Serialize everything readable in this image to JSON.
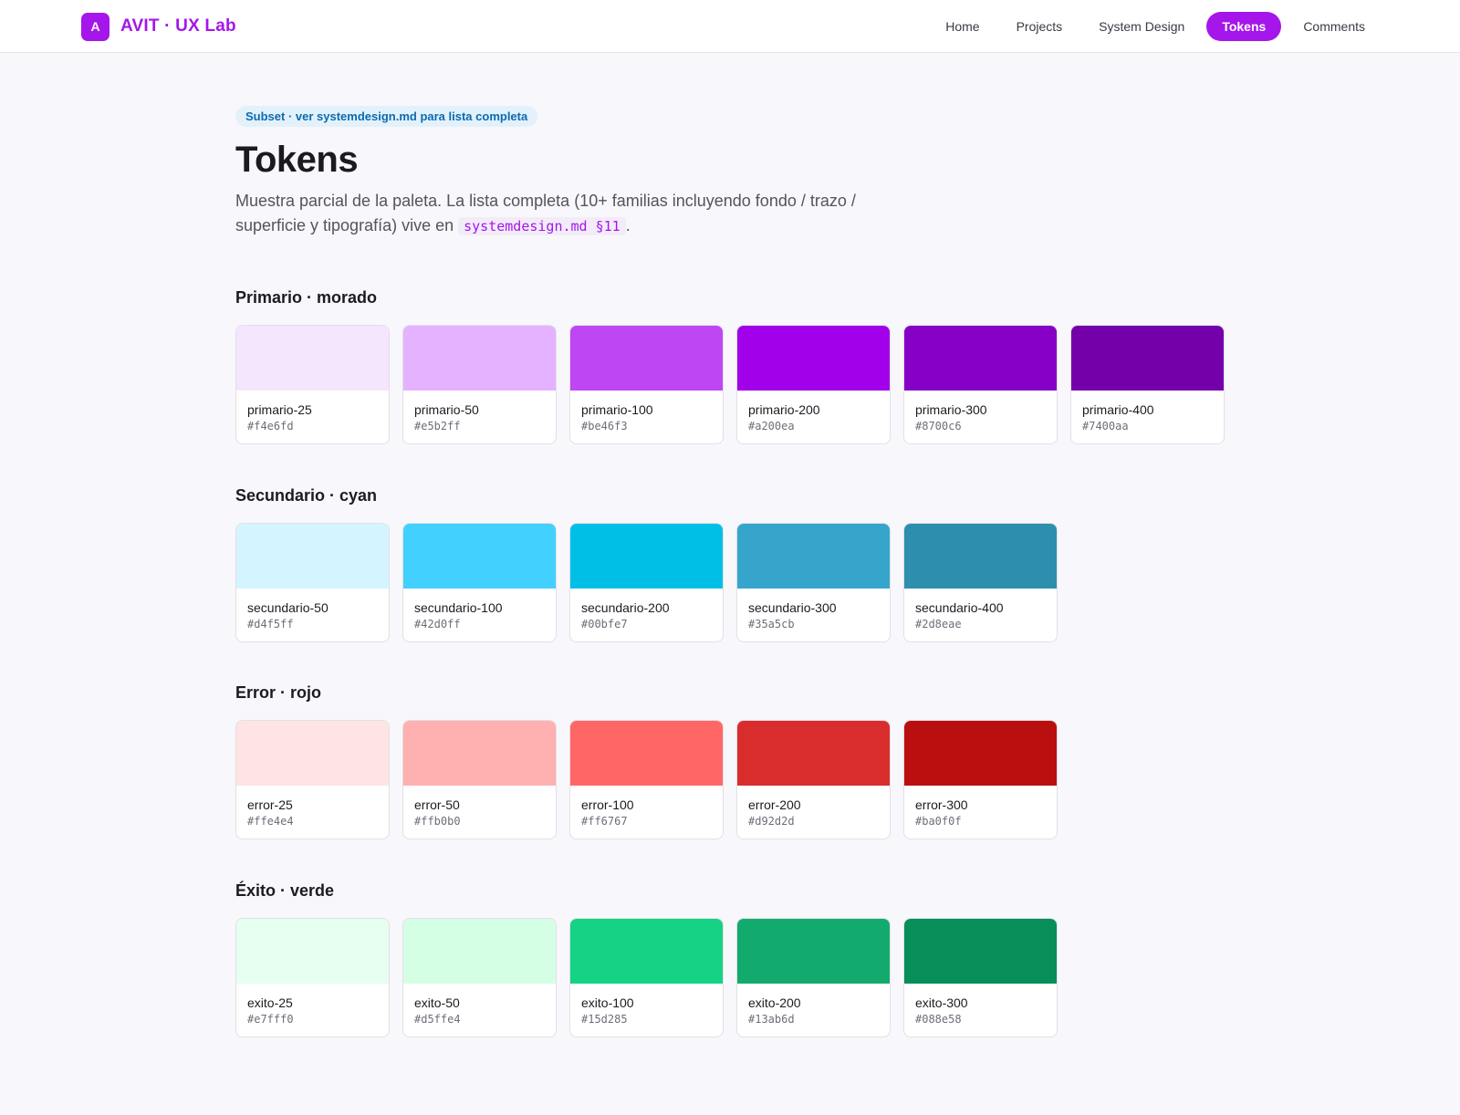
{
  "header": {
    "logo_letter": "A",
    "brand": "AVIT · UX Lab",
    "nav": [
      {
        "label": "Home",
        "active": false
      },
      {
        "label": "Projects",
        "active": false
      },
      {
        "label": "System Design",
        "active": false
      },
      {
        "label": "Tokens",
        "active": true
      },
      {
        "label": "Comments",
        "active": false
      }
    ]
  },
  "main": {
    "pill": "Subset · ver systemdesign.md para lista completa",
    "title": "Tokens",
    "lead_text": "Muestra parcial de la paleta. La lista completa (10+ familias incluyendo fondo / trazo / superficie y tipografía) vive en ",
    "lead_code": "systemdesign.md §11",
    "lead_end": "."
  },
  "sections": [
    {
      "title": "Primario · morado",
      "tokens": [
        {
          "name": "primario-25",
          "hex": "#f4e6fd"
        },
        {
          "name": "primario-50",
          "hex": "#e5b2ff"
        },
        {
          "name": "primario-100",
          "hex": "#be46f3"
        },
        {
          "name": "primario-200",
          "hex": "#a200ea"
        },
        {
          "name": "primario-300",
          "hex": "#8700c6"
        },
        {
          "name": "primario-400",
          "hex": "#7400aa"
        }
      ]
    },
    {
      "title": "Secundario · cyan",
      "tokens": [
        {
          "name": "secundario-50",
          "hex": "#d4f5ff"
        },
        {
          "name": "secundario-100",
          "hex": "#42d0ff"
        },
        {
          "name": "secundario-200",
          "hex": "#00bfe7"
        },
        {
          "name": "secundario-300",
          "hex": "#35a5cb"
        },
        {
          "name": "secundario-400",
          "hex": "#2d8eae"
        }
      ]
    },
    {
      "title": "Error · rojo",
      "tokens": [
        {
          "name": "error-25",
          "hex": "#ffe4e4"
        },
        {
          "name": "error-50",
          "hex": "#ffb0b0"
        },
        {
          "name": "error-100",
          "hex": "#ff6767"
        },
        {
          "name": "error-200",
          "hex": "#d92d2d"
        },
        {
          "name": "error-300",
          "hex": "#ba0f0f"
        }
      ]
    },
    {
      "title": "Éxito · verde",
      "tokens": [
        {
          "name": "exito-25",
          "hex": "#e7fff0"
        },
        {
          "name": "exito-50",
          "hex": "#d5ffe4"
        },
        {
          "name": "exito-100",
          "hex": "#15d285"
        },
        {
          "name": "exito-200",
          "hex": "#13ab6d"
        },
        {
          "name": "exito-300",
          "hex": "#088e58"
        }
      ]
    }
  ]
}
